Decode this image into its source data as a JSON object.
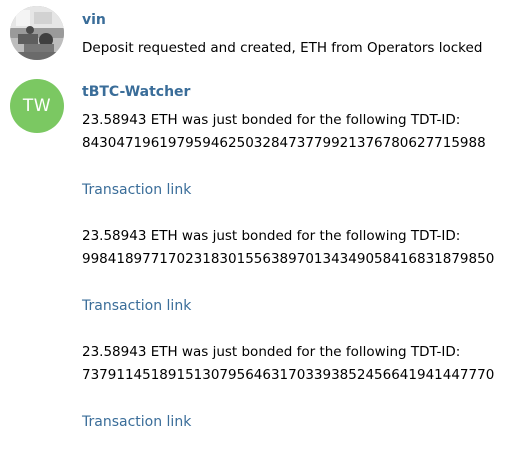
{
  "messages": [
    {
      "sender": "vin",
      "text": "Deposit requested and created, ETH from Operators locked"
    },
    {
      "sender": "tBTC-Watcher",
      "avatar_initials": "TW",
      "avatar_color": "#7bc862",
      "bonds": [
        {
          "line1": "23.58943 ETH was just bonded for the following TDT-ID:",
          "tdt_id": "84304719619795946250328473779921376780627715988",
          "link": "Transaction link"
        },
        {
          "line1": "23.58943 ETH was just bonded for the following TDT-ID:",
          "tdt_id": "99841897717023183015563897013434905841683187985​0",
          "link": "Transaction link"
        },
        {
          "line1": "23.58943 ETH was just bonded for the following TDT-ID:",
          "tdt_id": "737911451891513079564631703393852456641941447770",
          "link": "Transaction link"
        }
      ]
    }
  ],
  "colors": {
    "sender_name": "#3a6d99",
    "link": "#3a6d99",
    "background": "#ffffff"
  }
}
